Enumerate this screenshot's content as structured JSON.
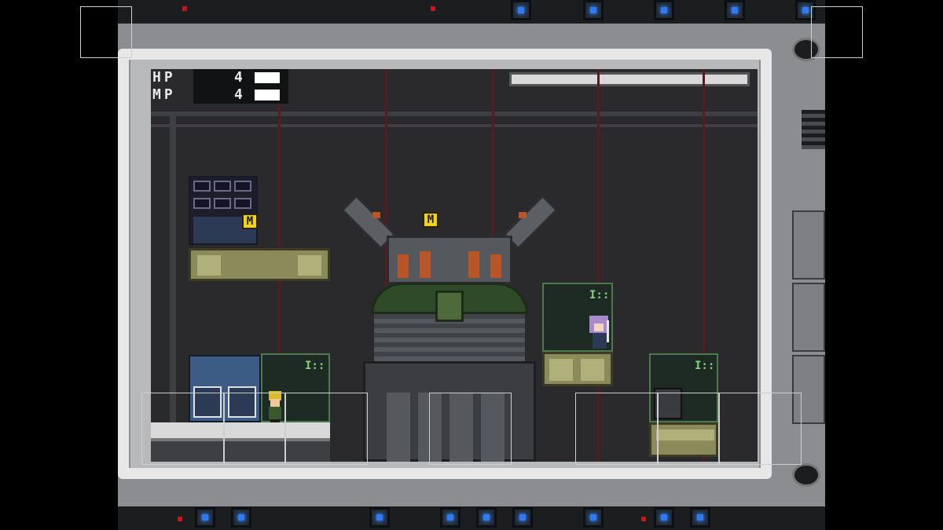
{
  "hud": {
    "hp_label": "HP",
    "hp_value": "4",
    "mp_label": "MP",
    "mp_value": "4",
    "hp_fill": 1.0,
    "mp_fill": 1.0
  },
  "pickups": {
    "memory_label_left": "M",
    "memory_label_center": "M"
  },
  "consoles": {
    "console_1_text": "I::",
    "console_2_text": "I::",
    "console_3_text": "I::"
  },
  "colors": {
    "frame": "#e7e7e7",
    "room_bg": "#2a2a2d",
    "hud_text": "#e8e8e8",
    "indicator_light": "#2a7bff",
    "pickup": "#f2d21c"
  },
  "icons": [
    "blue-indicator-light-icon",
    "memory-chip-icon",
    "gear-node-icon"
  ]
}
